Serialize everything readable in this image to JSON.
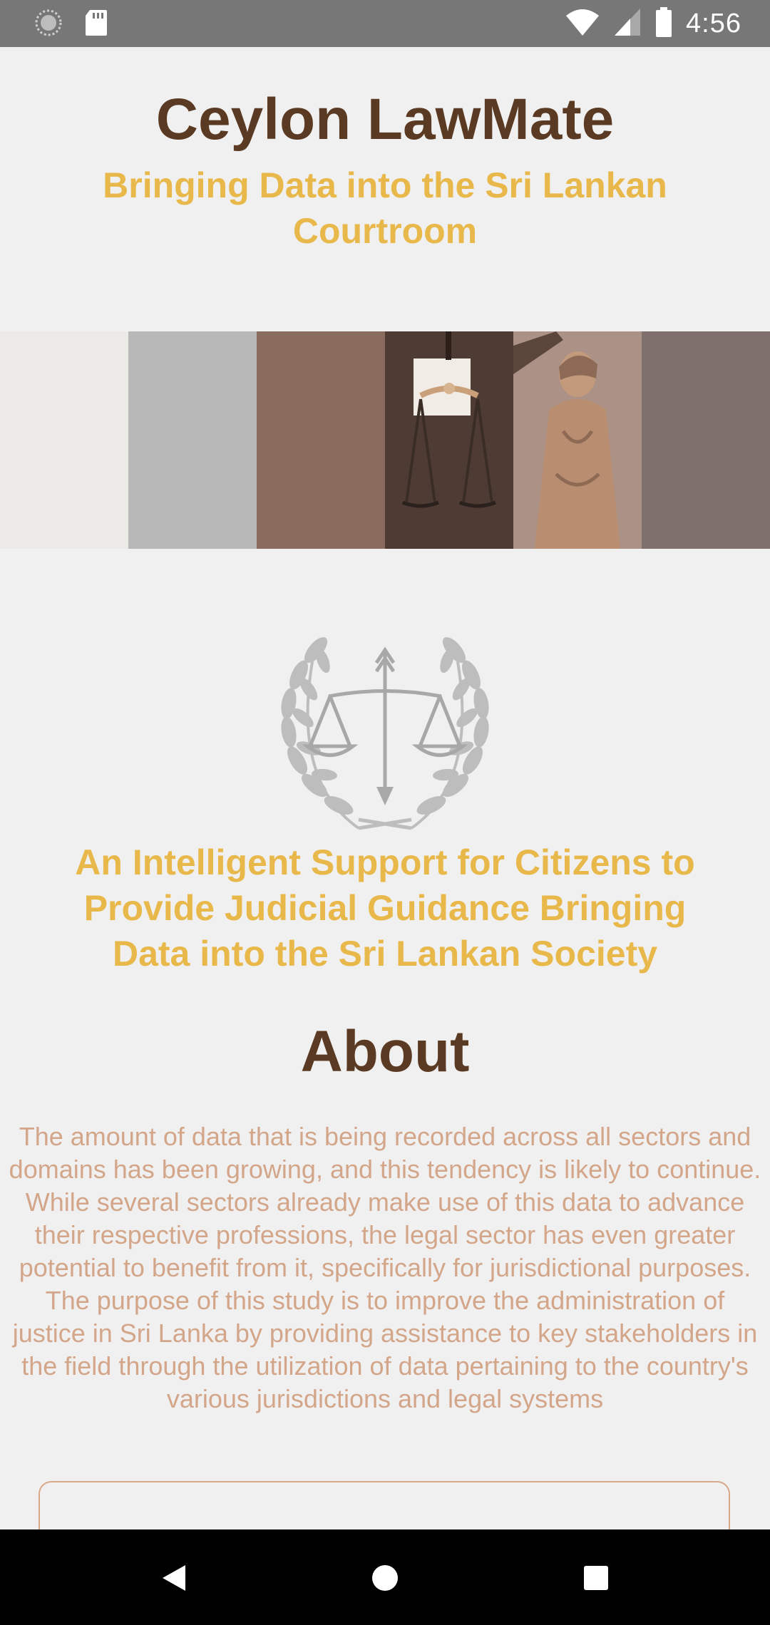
{
  "status_bar": {
    "time": "4:56",
    "icons": [
      "loading-icon",
      "sd-card-icon",
      "wifi-icon",
      "signal-icon",
      "battery-icon"
    ]
  },
  "header": {
    "title": "Ceylon LawMate",
    "subtitle": "Bringing Data into the Sri Lankan Courtroom"
  },
  "banner": {
    "description_icon": "lady-justice-banner"
  },
  "emblem": {
    "icon": "scales-laurel-icon"
  },
  "tagline": "An Intelligent Support for Citizens to Provide Judicial Guidance Bringing Data into the Sri Lankan Society",
  "about": {
    "heading": "About",
    "text": "The amount of data that is being recorded across all sectors and domains has been growing, and this tendency is likely to continue. While several sectors already make use of this data to advance their respective professions, the legal sector has even greater potential to benefit from it, specifically for jurisdictional purposes. The purpose of this study is to improve the administration of justice in Sri Lanka by providing assistance to key stakeholders in the field through the utilization of data pertaining to the country's various jurisdictions and legal systems"
  },
  "nav_bar": {
    "buttons": [
      "back-icon",
      "home-icon",
      "recents-icon"
    ]
  },
  "colors": {
    "title": "#5a3a22",
    "accent": "#e8b84a",
    "body_text": "#d3a68a",
    "background": "#f1f0f0",
    "status_bar": "#777777"
  }
}
